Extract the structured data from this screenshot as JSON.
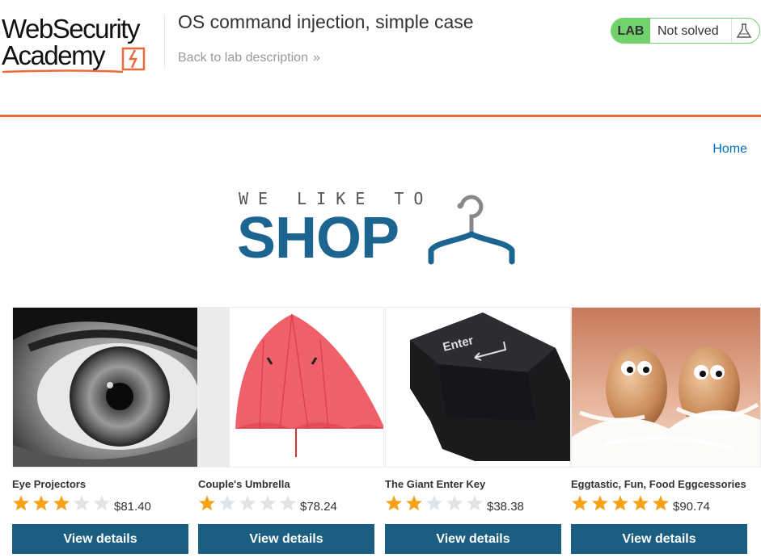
{
  "header": {
    "logo_line1": "WebSecurity",
    "logo_line2": "Academy",
    "lab_title": "OS command injection, simple case",
    "back_link": "Back to lab description",
    "back_chevrons": "»",
    "lab_badge": "LAB",
    "status": "Not solved",
    "accent_color": "#ee6a3b",
    "status_color": "#70d16d"
  },
  "nav": {
    "home": "Home"
  },
  "banner": {
    "top_text": "WE LIKE TO",
    "main_text": "SHOP"
  },
  "products": [
    {
      "name": "Eye Projectors",
      "rating": 3,
      "price": "$81.40",
      "button": "View details"
    },
    {
      "name": "Couple's Umbrella",
      "rating": 1,
      "price": "$78.24",
      "button": "View details"
    },
    {
      "name": "The Giant Enter Key",
      "rating": 2,
      "price": "$38.38",
      "button": "View details"
    },
    {
      "name": "Eggtastic, Fun, Food Eggcessories",
      "rating": 5,
      "price": "$90.74",
      "button": "View details"
    }
  ],
  "images": {
    "product_0_key_label": "Enter"
  },
  "colors": {
    "button_bg": "#1a5e82",
    "star_filled": "#f7a21b",
    "star_empty": "#dfe4e8",
    "link": "#0071bc"
  }
}
